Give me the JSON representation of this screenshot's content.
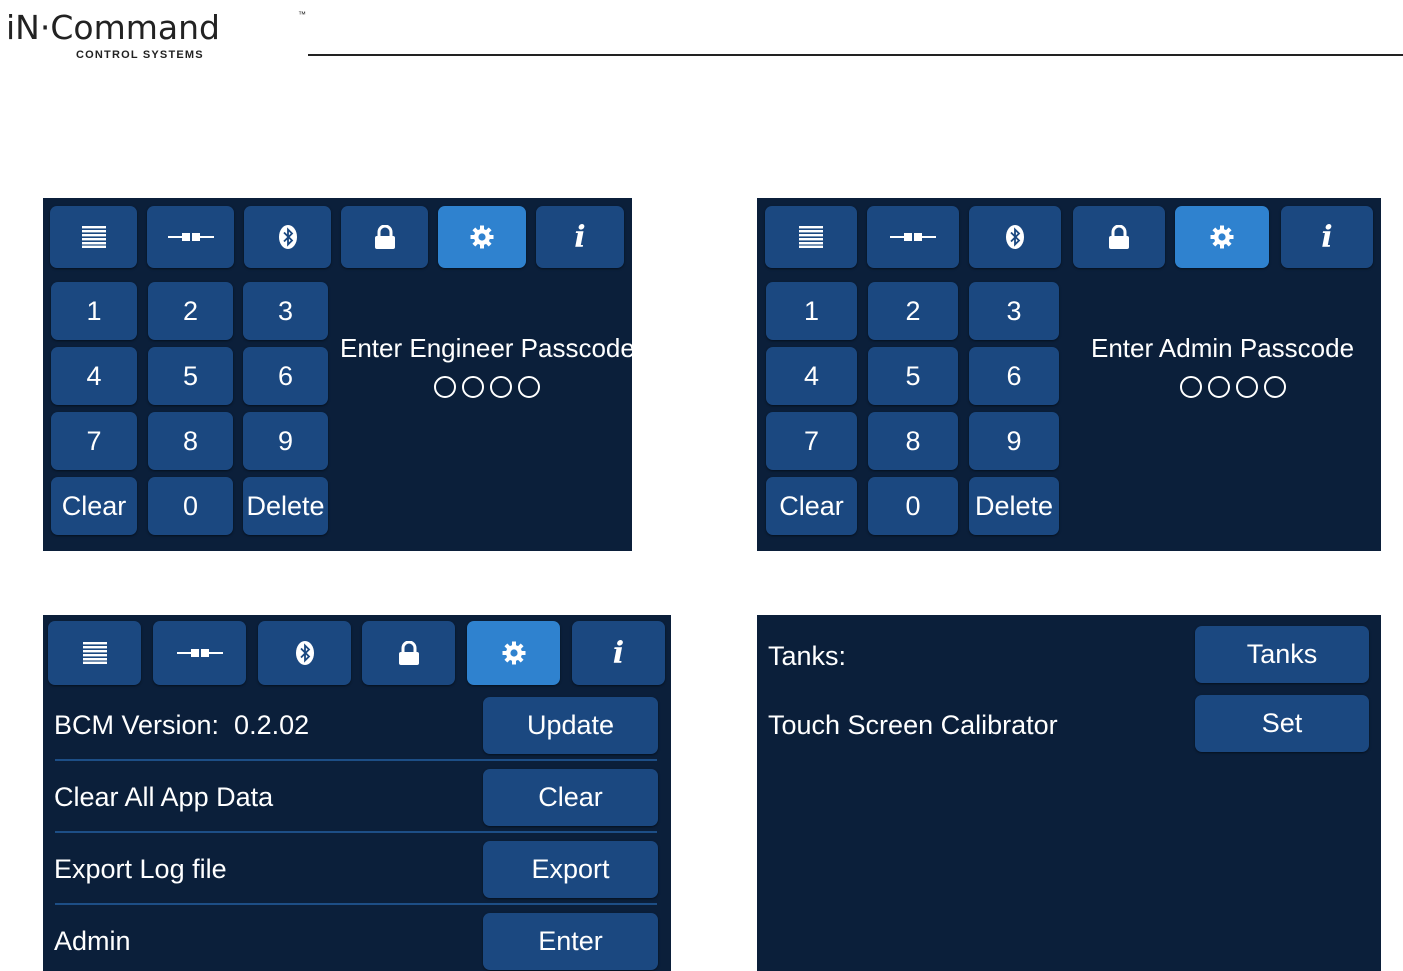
{
  "logo": {
    "main": "iN·Command",
    "tm": "™",
    "sub": "CONTROL SYSTEMS"
  },
  "tabs": [
    {
      "icon": "list-icon"
    },
    {
      "icon": "connection-icon"
    },
    {
      "icon": "bluetooth-icon"
    },
    {
      "icon": "lock-icon"
    },
    {
      "icon": "gear-icon",
      "active": true
    },
    {
      "icon": "info-icon",
      "label": "i"
    }
  ],
  "keypad": [
    "1",
    "2",
    "3",
    "4",
    "5",
    "6",
    "7",
    "8",
    "9",
    "Clear",
    "0",
    "Delete"
  ],
  "engineer_panel": {
    "prompt": "Enter Engineer Passcode",
    "passcode_length": 4
  },
  "admin_panel": {
    "prompt": "Enter Admin Passcode",
    "passcode_length": 4
  },
  "settings_panel": {
    "rows": [
      {
        "label": "BCM Version:  0.2.02",
        "button": "Update"
      },
      {
        "label": "Clear All App Data",
        "button": "Clear"
      },
      {
        "label": "Export Log file",
        "button": "Export"
      },
      {
        "label": "Admin",
        "button": "Enter"
      }
    ]
  },
  "admin_options_panel": {
    "rows": [
      {
        "label": "Tanks:",
        "button": "Tanks"
      },
      {
        "label": "Touch Screen Calibrator",
        "button": "Set"
      }
    ]
  },
  "colors": {
    "panel_bg": "#0b1f3a",
    "button": "#1b4880",
    "active_tab": "#2f82cf",
    "text": "#ffffff"
  }
}
